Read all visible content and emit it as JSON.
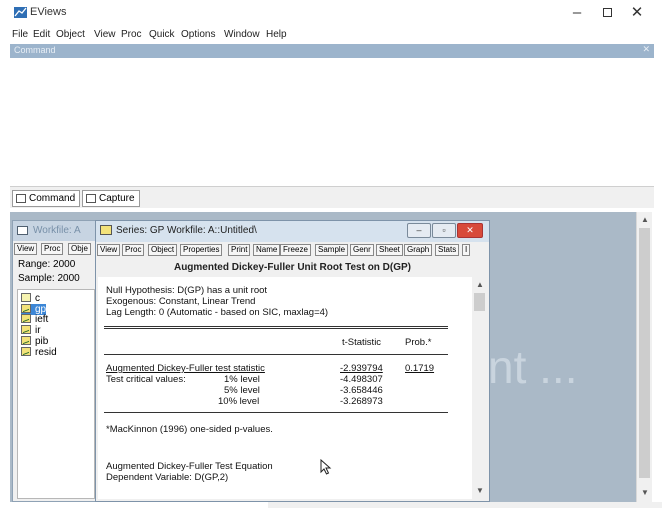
{
  "app": {
    "title": "EViews"
  },
  "menu": [
    "File",
    "Edit",
    "Object",
    "View",
    "Proc",
    "Quick",
    "Options",
    "Window",
    "Help"
  ],
  "command_panel": {
    "header": "Command",
    "close_glyph": "✕"
  },
  "bottom_tabs": [
    "Command",
    "Capture"
  ],
  "watermark": "nt ...",
  "workfile_window": {
    "title": "Workfile: A",
    "toolbar": [
      "View",
      "Proc",
      "Obje"
    ],
    "range": "Range:  2000",
    "sample": "Sample: 2000",
    "objects": [
      "c",
      "gp",
      "ieft",
      "ir",
      "pib",
      "resid"
    ],
    "selected": "gp"
  },
  "series_window": {
    "title": "Series: GP   Workfile: A::Untitled\\",
    "toolbar": [
      "View",
      "Proc",
      "Object",
      "Properties",
      "Print",
      "Name",
      "Freeze",
      "Sample",
      "Genr",
      "Sheet",
      "Graph",
      "Stats",
      "I"
    ],
    "header": "Augmented Dickey-Fuller Unit Root Test on D(GP)",
    "null_hypothesis": "Null Hypothesis: D(GP) has a unit root",
    "exogenous": "Exogenous: Constant, Linear Trend",
    "lag_length": "Lag Length: 0 (Automatic - based on SIC, maxlag=4)",
    "col_tstat": "t-Statistic",
    "col_prob": "Prob.*",
    "adf_label": "Augmented Dickey-Fuller test statistic",
    "adf_tstat": "-2.939794",
    "adf_prob": "0.1719",
    "crit_label": "Test critical values:",
    "levels": [
      {
        "label": "1% level",
        "value": "-4.498307"
      },
      {
        "label": "5% level",
        "value": "-3.658446"
      },
      {
        "label": "10% level",
        "value": "-3.268973"
      }
    ],
    "footnote": "*MacKinnon (1996) one-sided p-values.",
    "equation_title": "Augmented Dickey-Fuller Test Equation",
    "dependent_variable": "Dependent Variable: D(GP,2)"
  },
  "colors": {
    "command_header": "#9cb4cc",
    "workarea": "#aab9c7",
    "close_button": "#d84a3a",
    "selection": "#3c86d6"
  }
}
